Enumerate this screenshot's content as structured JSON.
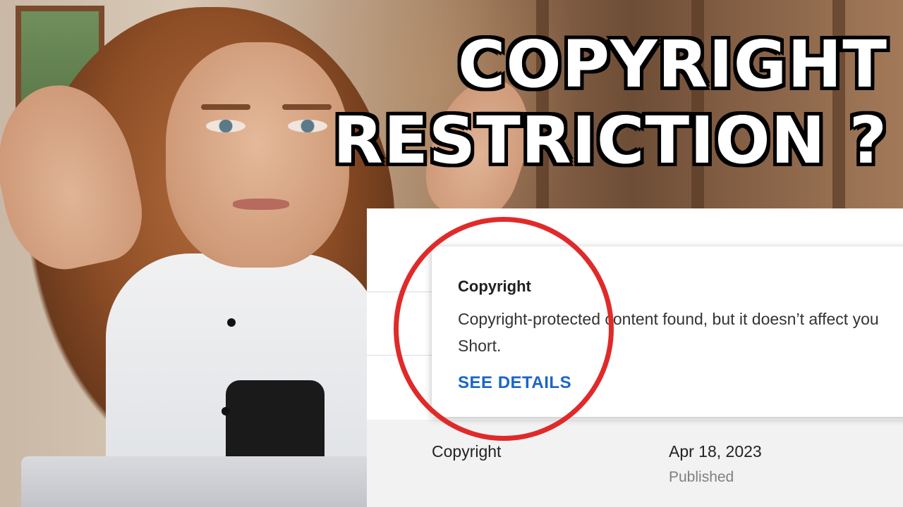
{
  "headline": {
    "line1": "COPYRIGHT",
    "line2": "RESTRICTION ?"
  },
  "popup": {
    "title": "Copyright",
    "body_line1": "Copyright-protected content found, but it doesn’t affect you",
    "body_line2": "Short.",
    "link": "SEE DETAILS"
  },
  "table_row": {
    "label": "Copyright",
    "date": "Apr 18, 2023",
    "status": "Published"
  },
  "colors": {
    "annotation": "#e02a2a",
    "link": "#1a66c8",
    "status_text": "#808080"
  },
  "icons": [
    "annotation-circle"
  ]
}
